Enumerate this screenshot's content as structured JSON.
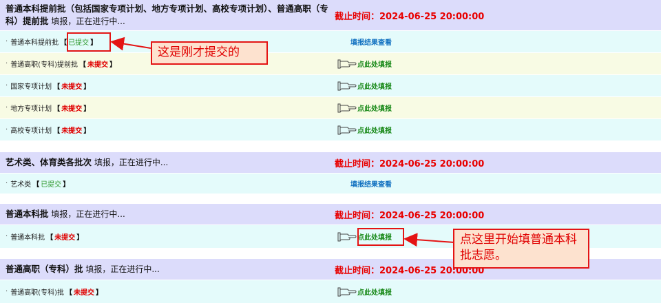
{
  "sections": [
    {
      "title_bold": "普通本科提前批（包括国家专项计划、地方专项计划、高校专项计划）、普通高职（专科）提前批",
      "title_rest": " 填报，正在进行中...",
      "deadline": "截止时间：2024-06-25 20:00:00",
      "items": [
        {
          "name": "普通本科提前批",
          "status": "已提交",
          "submitted": true,
          "action": "填报结果查看"
        },
        {
          "name": "普通高职(专科)提前批",
          "status": "未提交",
          "submitted": false,
          "action": "点此处填报"
        },
        {
          "name": "国家专项计划",
          "status": "未提交",
          "submitted": false,
          "action": "点此处填报"
        },
        {
          "name": "地方专项计划",
          "status": "未提交",
          "submitted": false,
          "action": "点此处填报"
        },
        {
          "name": "高校专项计划",
          "status": "未提交",
          "submitted": false,
          "action": "点此处填报"
        }
      ]
    },
    {
      "title_bold": "艺术类、体育类各批次",
      "title_rest": " 填报，正在进行中...",
      "deadline": "截止时间：2024-06-25 20:00:00",
      "items": [
        {
          "name": "艺术类",
          "status": "已提交",
          "submitted": true,
          "action": "填报结果查看"
        }
      ]
    },
    {
      "title_bold": "普通本科批",
      "title_rest": " 填报，正在进行中...",
      "deadline": "截止时间：2024-06-25 20:00:00",
      "items": [
        {
          "name": "普通本科批",
          "status": "未提交",
          "submitted": false,
          "action": "点此处填报"
        }
      ]
    },
    {
      "title_bold": "普通高职（专科）批",
      "title_rest": " 填报，正在进行中...",
      "deadline": "截止时间：2024-06-25 20:00:00",
      "items": [
        {
          "name": "普通高职(专科)批",
          "status": "未提交",
          "submitted": false,
          "action": "点此处填报"
        }
      ]
    }
  ],
  "brackets": {
    "open": "【",
    "close": "】"
  },
  "bullet": "·",
  "annotations": {
    "callout_submitted": "这是刚才提交的",
    "callout_start": "点这里开始填普通本科批志愿。"
  },
  "colors": {
    "header_bg": "#dcdcfb",
    "deadline": "#e80000",
    "submitted": "#2f9a2f",
    "not_submitted": "#e00000",
    "view_link": "#1070c0",
    "fill_link": "#1a8a1a",
    "annotation_red": "#e41414"
  },
  "icons": {
    "fill_action": "pointing-hand-icon"
  }
}
